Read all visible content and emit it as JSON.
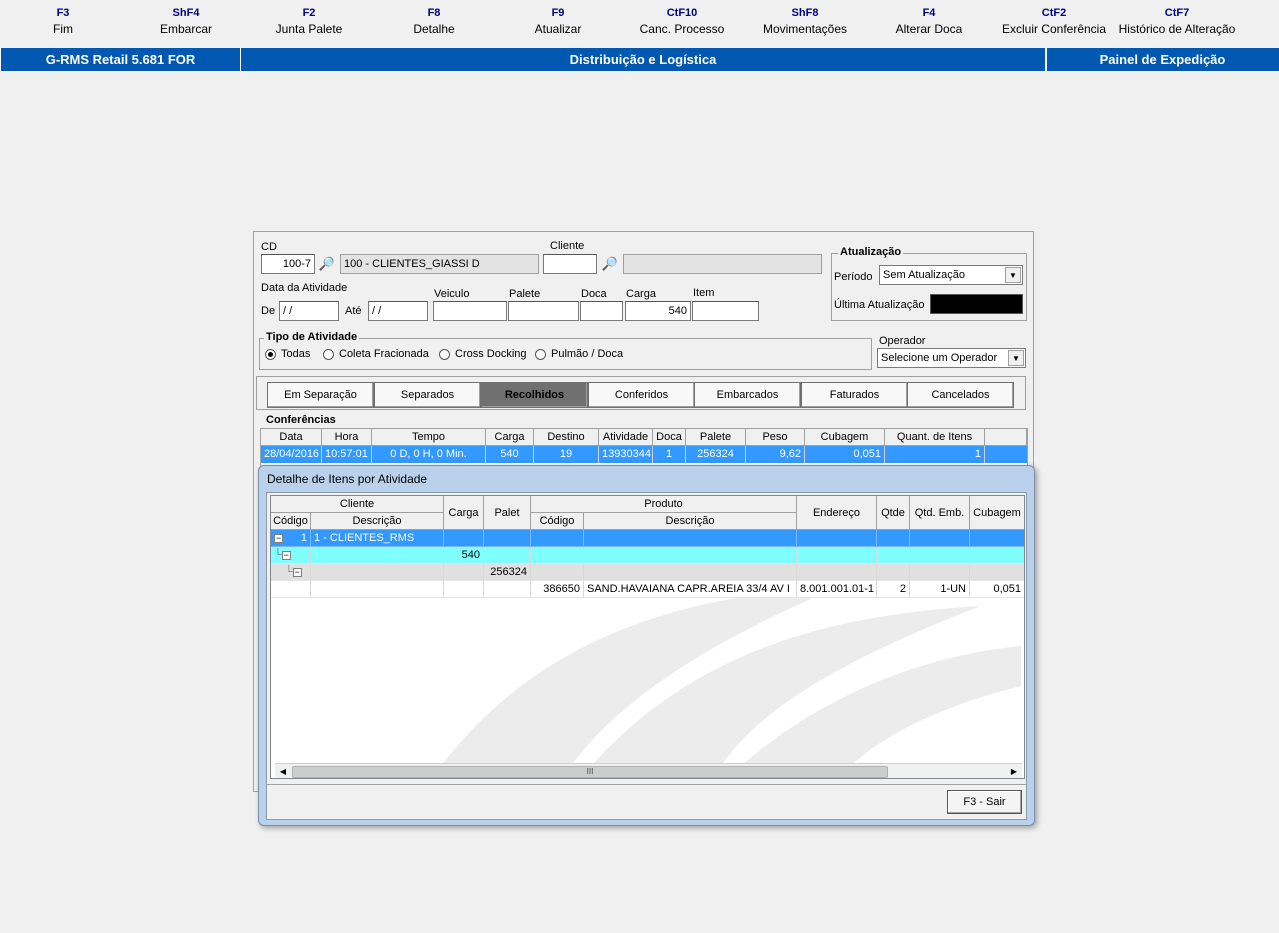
{
  "fkeys": [
    {
      "key": "F3",
      "label": "Fim"
    },
    {
      "key": "ShF4",
      "label": "Embarcar"
    },
    {
      "key": "F2",
      "label": "Junta Palete"
    },
    {
      "key": "F8",
      "label": "Detalhe"
    },
    {
      "key": "F9",
      "label": "Atualizar"
    },
    {
      "key": "CtF10",
      "label": "Canc. Processo"
    },
    {
      "key": "ShF8",
      "label": "Movimentações"
    },
    {
      "key": "F4",
      "label": "Alterar Doca"
    },
    {
      "key": "CtF2",
      "label": "Excluir Conferência"
    },
    {
      "key": "CtF7",
      "label": "Histórico de Alteração"
    }
  ],
  "header": {
    "app": "G-RMS Retail 5.681 FOR",
    "module": "Distribuição e Logística",
    "screen": "Painel de Expedição"
  },
  "form": {
    "cd_label": "CD",
    "cd_value": "100-7",
    "cd_desc": "100 - CLIENTES_GIASSI D",
    "cliente_label": "Cliente",
    "cliente_value": "",
    "cliente_desc": "",
    "data_label": "Data da Atividade",
    "de_label": "De",
    "de_value": " / /",
    "ate_label": "Até",
    "ate_value": " / /",
    "veiculo_label": "Veiculo",
    "veiculo_value": "",
    "palete_label": "Palete",
    "palete_value": "",
    "doca_label": "Doca",
    "doca_value": "",
    "carga_label": "Carga",
    "carga_value": "540",
    "item_label": "Item",
    "item_value": ""
  },
  "atualizacao": {
    "title": "Atualização",
    "periodo_label": "Período",
    "periodo_value": "Sem Atualização",
    "ultima_label": "Última Atualização",
    "ultima_color": "#000000"
  },
  "tipo": {
    "title": "Tipo de Atividade",
    "options": [
      "Todas",
      "Coleta Fracionada",
      "Cross Docking",
      "Pulmão / Doca"
    ],
    "selected": "Todas"
  },
  "operador": {
    "label": "Operador",
    "value": "Selecione um Operador"
  },
  "tabs": [
    "Em Separação",
    "Separados",
    "Recolhidos",
    "Conferidos",
    "Embarcados",
    "Faturados",
    "Cancelados"
  ],
  "active_tab": "Recolhidos",
  "conferencias": {
    "title": "Conferências",
    "columns": [
      "Data",
      "Hora",
      "Tempo",
      "Carga",
      "Destino",
      "Atividade",
      "Doca",
      "Palete",
      "Peso",
      "Cubagem",
      "Quant. de Itens"
    ],
    "rows": [
      [
        "28/04/2016",
        "10:57:01",
        "0 D, 0 H, 0 Min.",
        "540",
        "19",
        "13930344",
        "1",
        "256324",
        "9,62",
        "0,051",
        "1"
      ]
    ]
  },
  "dialog": {
    "title": "Detalhe de Itens por Atividade",
    "group_cliente": "Cliente",
    "group_produto": "Produto",
    "h_codigo": "Código",
    "h_descricao": "Descrição",
    "h_carga": "Carga",
    "h_palet": "Palet",
    "h_prod_codigo": "Código",
    "h_prod_descricao": "Descrição",
    "h_endereco": "Endereço",
    "h_qtde": "Qtde",
    "h_qtd_emb": "Qtd. Emb.",
    "h_cubagem": "Cubagem",
    "row_cliente_codigo": "1",
    "row_cliente_desc": "1 - CLIENTES_RMS",
    "row_carga": "540",
    "row_palet": "256324",
    "item": {
      "codigo": "386650",
      "descricao": "SAND.HAVAIANA CAPR.AREIA 33/4  AV  I",
      "endereco": "8.001.001.01-1",
      "qtde": "2",
      "qtd_emb": "1-UN",
      "cubagem": "0,051"
    },
    "scroll_grip": "III",
    "exit_button": "F3 - Sair"
  }
}
